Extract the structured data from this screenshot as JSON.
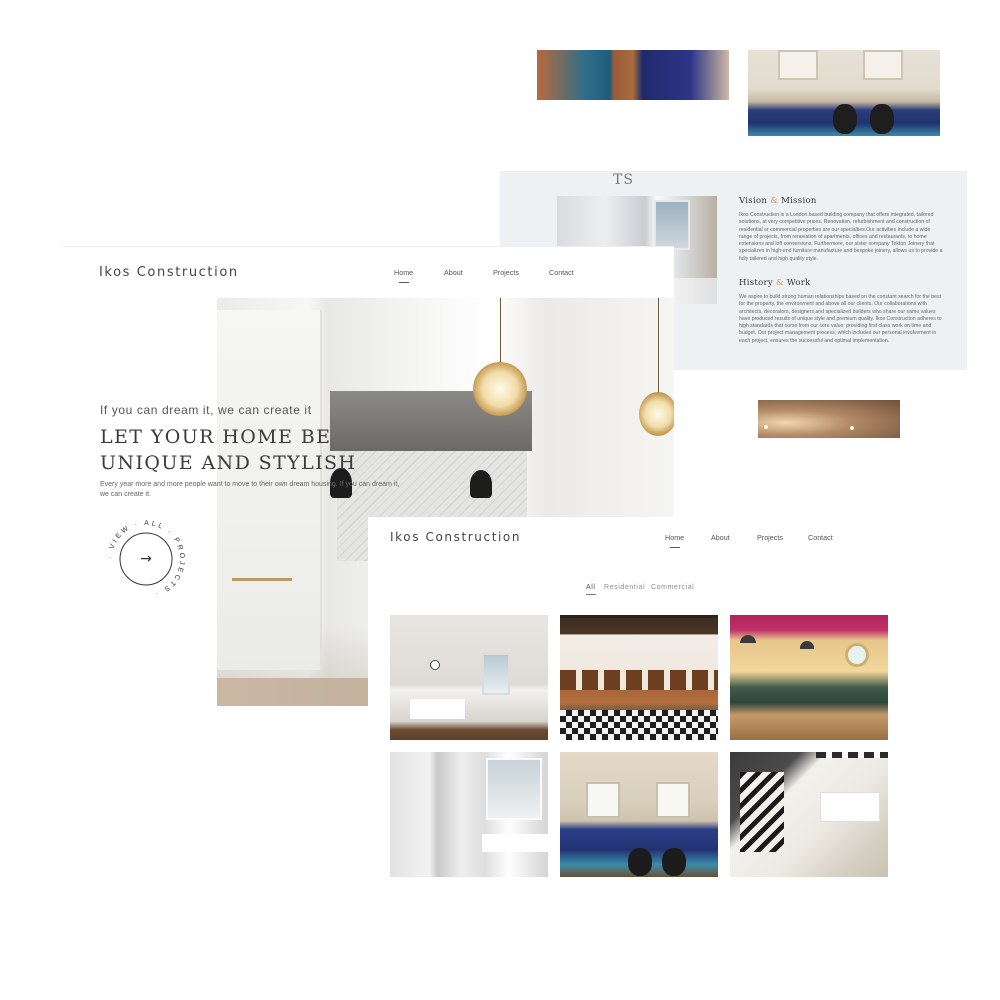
{
  "brand": "Ikos Construction",
  "nav": {
    "home": "Home",
    "about": "About",
    "projects": "Projects",
    "contact": "Contact"
  },
  "home": {
    "tagline": "If you can dream it, we can create it",
    "title_line1": "LET YOUR HOME BE",
    "title_line2": "UNIQUE AND STYLISH",
    "description": "Every year more and more people want to move to their own dream housing. If you can dream it, we can create it.",
    "overflow_fragment": "TS",
    "badge_text": "· VIEW · ALL · PROJECTS ·",
    "badge_arrow": "→"
  },
  "about": {
    "vision_heading_1": "Vision",
    "vision_heading_amp": "&",
    "vision_heading_2": "Mission",
    "vision_text": "Ikos Construction is a London based building company that offers integrated, tailored solutions, at very competitive prices. Renovation, refurbishment and construction of residential or commercial properties are our specialties.Our activities include a wide range of projects, from renovation of apartments, offices and restaurants, to home extensions and loft conversions. Furthermore, our sister company Tekton Joinery that specializes in high-end furniture manufacture and bespoke joinery, allows us to provide a fully tailored and high quality style.",
    "history_heading_1": "History",
    "history_heading_amp": "&",
    "history_heading_2": "Work",
    "history_text": "We aspire to build strong human relationships based on the constant search for the best for the property, the environment and above all our clients. Our collaborations with architects, decorators, designers and specialized builders who share our same values have produced results of unique style and premium quality. Ikos Construction adheres to high standards that come from our core value: providing first class work on time and budget. Our project management process, which includes our personal involvement in each project, ensures the successful and optimal implementation."
  },
  "projects": {
    "filters": [
      "All",
      "Residential",
      "Commercial"
    ]
  },
  "colors": {
    "accent_amp": "#c2a24a",
    "about_bg": "#eef1f4",
    "text_dark": "#3b3b3b"
  }
}
